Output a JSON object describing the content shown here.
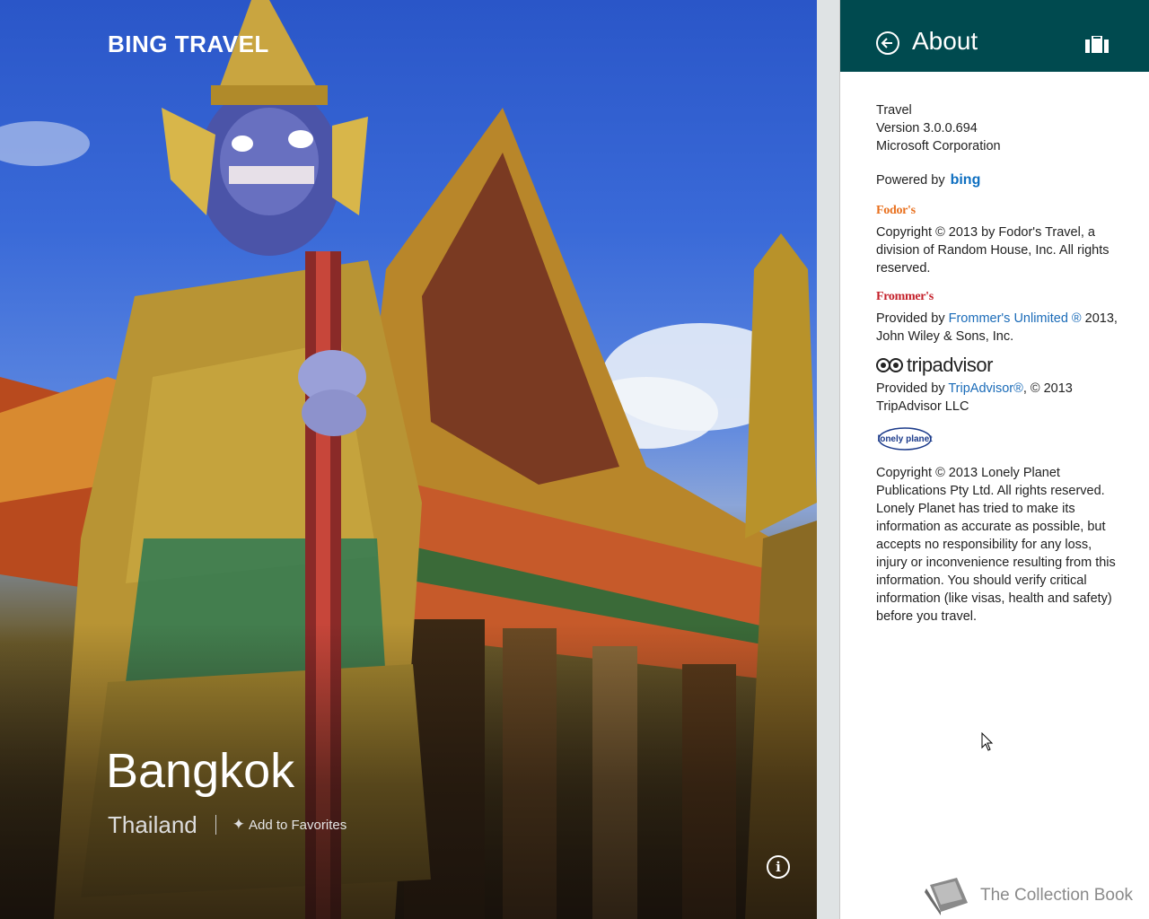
{
  "app": {
    "title": "BING TRAVEL"
  },
  "destination": {
    "city": "Bangkok",
    "country": "Thailand",
    "favorite_label": "Add to Favorites"
  },
  "icons": {
    "favorite": "pin-star-icon",
    "info": "info-icon",
    "back": "back-arrow-icon",
    "suitcase": "suitcase-icon",
    "book": "book-icon"
  },
  "about": {
    "title": "About",
    "app_name": "Travel",
    "version": "Version 3.0.0.694",
    "company": "Microsoft Corporation",
    "powered_by": "Powered by",
    "powered_logo": "bing",
    "fodors": {
      "logo": "Fodor's",
      "text": "Copyright © 2013 by Fodor's Travel, a division of Random House, Inc. All rights reserved."
    },
    "frommers": {
      "logo": "Frommer's",
      "prefix": "Provided by ",
      "link": "Frommer's Unlimited ®",
      "suffix": " 2013, John Wiley & Sons, Inc."
    },
    "tripadvisor": {
      "logo": "tripadvisor",
      "prefix": "Provided by ",
      "link": "TripAdvisor®",
      "suffix": ", © 2013 TripAdvisor LLC"
    },
    "lonely_planet": {
      "logo": "lonely planet",
      "copyright": "Copyright © 2013 Lonely Planet Publications Pty Ltd. All rights reserved.",
      "disclaimer": "Lonely Planet has tried to make its information as accurate as possible, but accepts no responsibility for any loss, injury or inconvenience resulting from this information. You should verify critical information (like visas, health and safety) before you travel."
    }
  },
  "watermark": {
    "text": "The Collection Book"
  },
  "colors": {
    "header_bg": "#004a4f",
    "link": "#1a6bb8",
    "fodors": "#e8701e",
    "frommers": "#c4202a",
    "bing": "#0e6fc0"
  }
}
